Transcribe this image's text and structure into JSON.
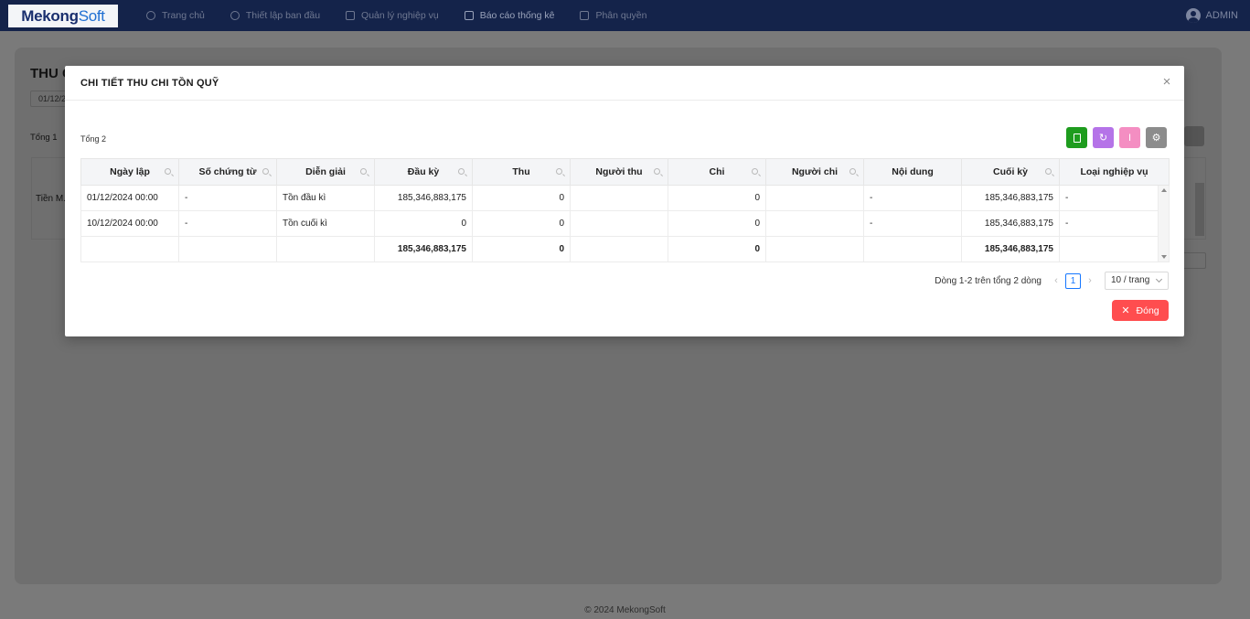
{
  "nav": {
    "logo_a": "Mekong",
    "logo_b": "Soft",
    "items": [
      {
        "label": "Trang chủ"
      },
      {
        "label": "Thiết lập ban đầu"
      },
      {
        "label": "Quản lý nghiệp vụ"
      },
      {
        "label": "Báo cáo thống kê"
      },
      {
        "label": "Phân quyền"
      }
    ],
    "user": "ADMIN"
  },
  "background": {
    "title": "THU C",
    "date": "01/12/2",
    "total": "Tổng 1",
    "row_label": "Tiền M."
  },
  "modal": {
    "title": "CHI TIẾT THU CHI TỒN QUỸ",
    "close_symbol": "×",
    "total_label": "Tổng 2",
    "table": {
      "columns": [
        "Ngày lập",
        "Số chứng từ",
        "Diễn giải",
        "Đầu kỳ",
        "Thu",
        "Người thu",
        "Chi",
        "Người chi",
        "Nội dung",
        "Cuối kỳ",
        "Loại nghiệp vụ"
      ],
      "rows": [
        [
          "01/12/2024 00:00",
          "-",
          "Tồn đầu kì",
          "185,346,883,175",
          "0",
          "",
          "0",
          "",
          "-",
          "185,346,883,175",
          "-"
        ],
        [
          "10/12/2024 00:00",
          "-",
          "Tồn cuối kì",
          "0",
          "0",
          "",
          "0",
          "",
          "-",
          "185,346,883,175",
          "-"
        ]
      ],
      "summary": [
        "",
        "",
        "",
        "185,346,883,175",
        "0",
        "",
        "0",
        "",
        "",
        "185,346,883,175",
        ""
      ]
    },
    "pagination": {
      "info": "Dòng 1-2 trên tổng 2 dòng",
      "current_page": "1",
      "page_size": "10 / trang"
    },
    "close_button": "Đóng"
  },
  "footer": "© 2024 MekongSoft",
  "colors": {
    "nav_bg": "#14234a",
    "excel": "#1e9c1e",
    "reload": "#b573e8",
    "columns": "#f48ec2",
    "settings": "#8c8c8c",
    "danger": "#ff4d4f",
    "primary": "#1677ff"
  }
}
